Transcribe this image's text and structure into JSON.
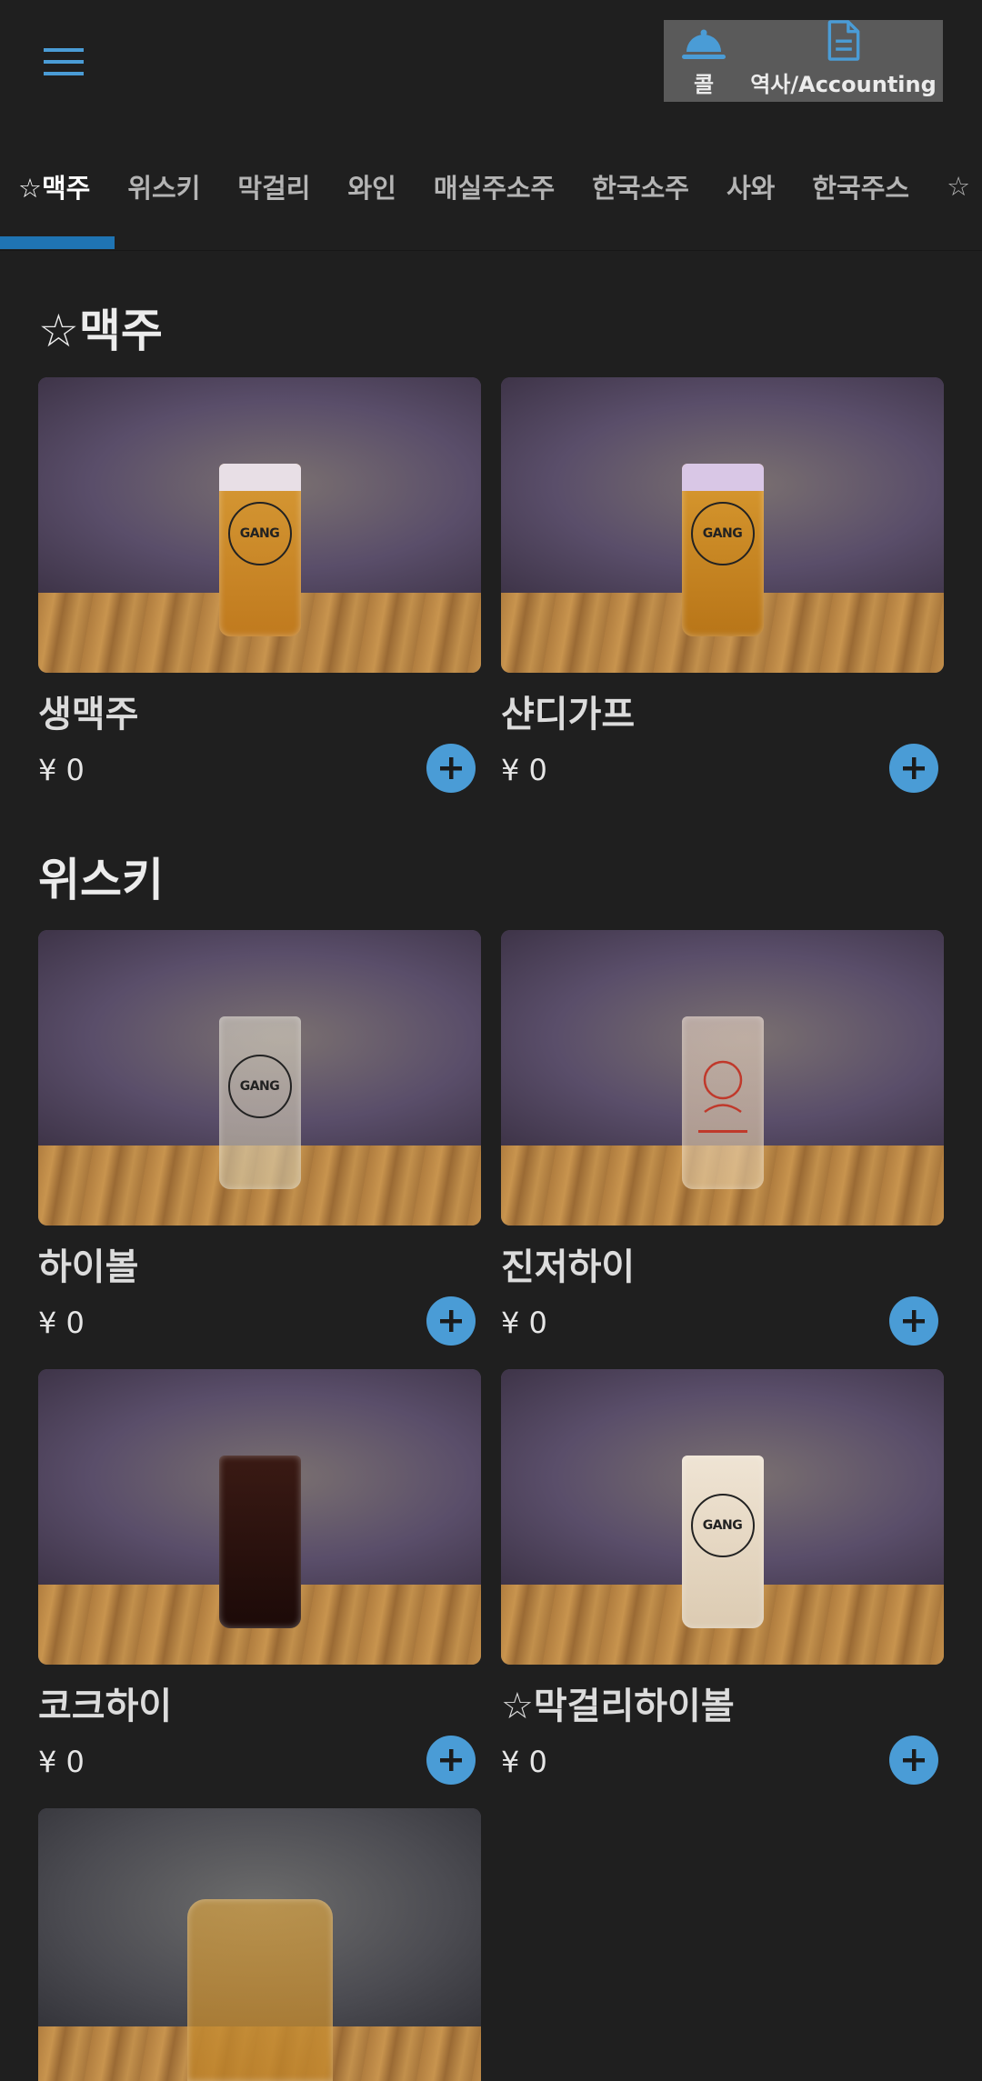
{
  "header": {
    "menu_icon": "hamburger-icon",
    "call": {
      "label": "콜",
      "icon": "service-bell-icon"
    },
    "history": {
      "label": "역사/Accounting",
      "icon": "document-icon"
    }
  },
  "tabs": [
    {
      "label": "☆맥주",
      "active": true
    },
    {
      "label": "위스키"
    },
    {
      "label": "막걸리"
    },
    {
      "label": "와인"
    },
    {
      "label": "매실주소주"
    },
    {
      "label": "한국소주"
    },
    {
      "label": "사와"
    },
    {
      "label": "한국주스"
    },
    {
      "label": "☆"
    }
  ],
  "sections": [
    {
      "title": "☆맥주",
      "items": [
        {
          "name": "생맥주",
          "price": "¥ 0"
        },
        {
          "name": "샨디가프",
          "price": "¥ 0"
        }
      ]
    },
    {
      "title": "위스키",
      "items": [
        {
          "name": "하이볼",
          "price": "¥ 0"
        },
        {
          "name": "진저하이",
          "price": "¥ 0"
        },
        {
          "name": "코크하이",
          "price": "¥ 0"
        },
        {
          "name": "☆막걸리하이볼",
          "price": "¥ 0"
        }
      ]
    }
  ],
  "photo_logo_text": "GANG",
  "colors": {
    "accent": "#4a9cd6",
    "tab_indicator": "#1f74b3",
    "background": "#1f1f1f"
  }
}
